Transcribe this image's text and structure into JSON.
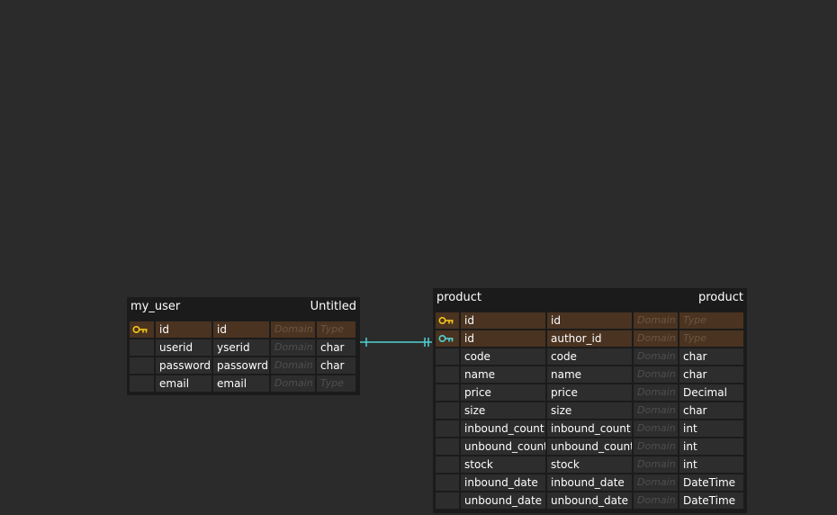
{
  "colors": {
    "background": "#2b2b2b",
    "entity_bg": "#1b1b1b",
    "cell_bg": "#2d2d2d",
    "pk_row_bg": "#4a3320",
    "primary_key_icon": "#f5c518",
    "foreign_key_icon": "#4fd1d0",
    "relation_line": "#4fd1d0"
  },
  "entities": {
    "my_user": {
      "name": "my_user",
      "schema": "Untitled",
      "columns": [
        {
          "key": "primary-key-icon",
          "logical": "id",
          "physical": "id",
          "domain": "Domain",
          "type": "Type",
          "pk": true
        },
        {
          "key": "",
          "logical": "userid",
          "physical": "yserid",
          "domain": "Domain",
          "type": "char",
          "pk": false
        },
        {
          "key": "",
          "logical": "password",
          "physical": "passowrd",
          "domain": "Domain",
          "type": "char",
          "pk": false
        },
        {
          "key": "",
          "logical": "email",
          "physical": "email",
          "domain": "Domain",
          "type": "Type",
          "pk": false
        }
      ]
    },
    "product": {
      "name": "product",
      "schema": "product",
      "columns": [
        {
          "key": "primary-key-icon",
          "logical": "id",
          "physical": "id",
          "domain": "Domain",
          "type": "Type",
          "pk": true
        },
        {
          "key": "foreign-key-icon",
          "logical": "id",
          "physical": "author_id",
          "domain": "Domain",
          "type": "Type",
          "pk": true
        },
        {
          "key": "",
          "logical": "code",
          "physical": "code",
          "domain": "Domain",
          "type": "char",
          "pk": false
        },
        {
          "key": "",
          "logical": "name",
          "physical": "name",
          "domain": "Domain",
          "type": "char",
          "pk": false
        },
        {
          "key": "",
          "logical": "price",
          "physical": "price",
          "domain": "Domain",
          "type": "Decimal",
          "pk": false
        },
        {
          "key": "",
          "logical": "size",
          "physical": "size",
          "domain": "Domain",
          "type": "char",
          "pk": false
        },
        {
          "key": "",
          "logical": "inbound_count",
          "physical": "inbound_count",
          "domain": "Domain",
          "type": "int",
          "pk": false
        },
        {
          "key": "",
          "logical": "unbound_count",
          "physical": "unbound_count",
          "domain": "Domain",
          "type": "int",
          "pk": false
        },
        {
          "key": "",
          "logical": "stock",
          "physical": "stock",
          "domain": "Domain",
          "type": "int",
          "pk": false
        },
        {
          "key": "",
          "logical": "inbound_date",
          "physical": "inbound_date",
          "domain": "Domain",
          "type": "DateTime",
          "pk": false
        },
        {
          "key": "",
          "logical": "unbound_date",
          "physical": "unbound_date",
          "domain": "Domain",
          "type": "DateTime",
          "pk": false
        }
      ]
    }
  }
}
